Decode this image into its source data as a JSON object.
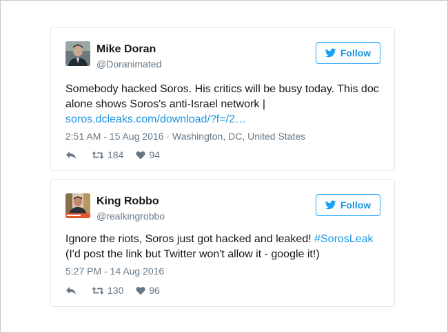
{
  "colors": {
    "brand": "#1da1f2",
    "link": "#1b95e0",
    "muted": "#657786",
    "text": "#14171a",
    "border": "#e1e8ed"
  },
  "tweets": [
    {
      "avatar_icon": "user-photo-avatar",
      "name": "Mike Doran",
      "handle": "@Doranimated",
      "follow_label": "Follow",
      "text_line1": "Somebody hacked Soros. His critics will be busy today. This doc",
      "text_line2": "alone shows Soros's anti-Israel network |",
      "link_text": "soros.dcleaks.com/download/?f=/2…",
      "time": "2:51 AM - 15 Aug 2016",
      "separator": " · ",
      "location": "Washington, DC, United States",
      "retweets": "184",
      "likes": "94"
    },
    {
      "avatar_icon": "user-photo-avatar",
      "name": "King Robbo",
      "handle": "@realkingrobbo",
      "follow_label": "Follow",
      "text_line1_pre": "Ignore the riots, Soros just got hacked and leaked! ",
      "hashtag": "#SorosLeak",
      "text_line2": "(I'd post the link but Twitter won't allow it - google it!)",
      "time": "5:27 PM - 14 Aug 2016",
      "retweets": "130",
      "likes": "96"
    }
  ]
}
